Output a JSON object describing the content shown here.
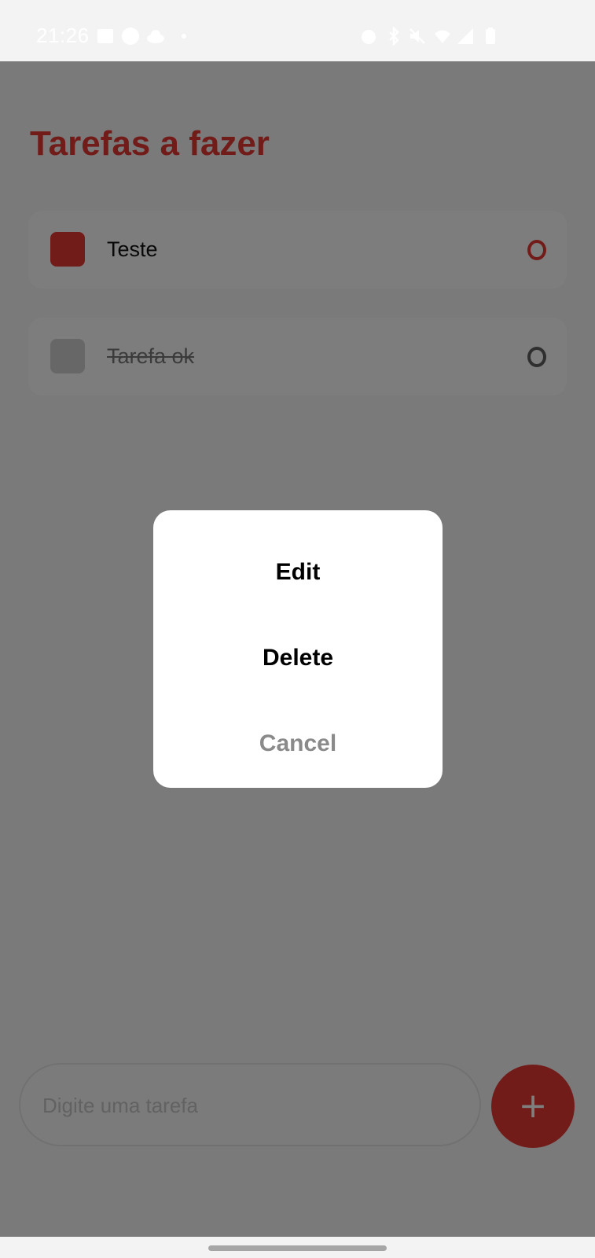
{
  "status_bar": {
    "time": "21:26",
    "icons": [
      "gallery-icon",
      "launcher-icon",
      "cloud-icon",
      "dot-icon",
      "alarm-icon",
      "bluetooth-icon",
      "mute-icon",
      "wifi-icon",
      "signal-icon",
      "battery-icon"
    ]
  },
  "app": {
    "title": "Tarefas a fazer",
    "colors": {
      "accent": "#e53935",
      "done_checkbox": "#cfcfcf",
      "done_circle": "#5f5f5f"
    },
    "tasks": [
      {
        "label": "Teste",
        "done": false,
        "status_icon": "circle-icon"
      },
      {
        "label": "Tarefa ok",
        "done": true,
        "status_icon": "circle-icon"
      }
    ],
    "input": {
      "placeholder": "Digite uma tarefa",
      "value": ""
    },
    "add_button": {
      "label": "+"
    }
  },
  "dialog": {
    "options": [
      {
        "label": "Edit"
      },
      {
        "label": "Delete"
      },
      {
        "label": "Cancel"
      }
    ]
  }
}
